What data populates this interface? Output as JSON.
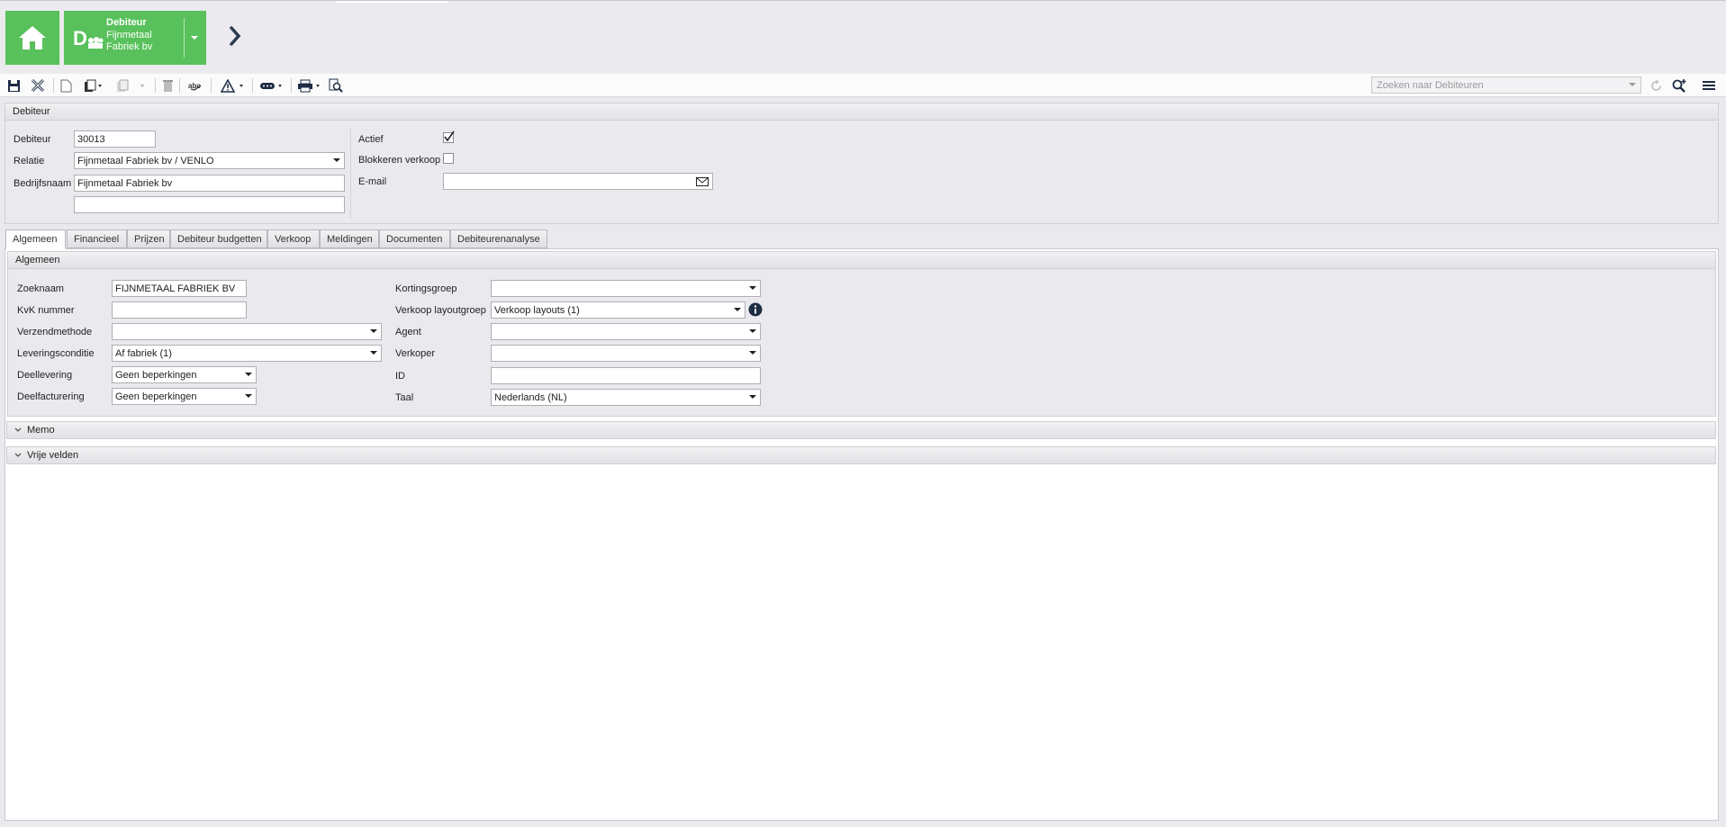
{
  "header": {
    "record_type": "Debiteur",
    "record_name": "Fijnmetaal Fabriek bv"
  },
  "toolbar": {
    "search_placeholder": "Zoeken naar Debiteuren"
  },
  "debiteur_panel": {
    "title": "Debiteur",
    "debiteur_label": "Debiteur",
    "debiteur_value": "30013",
    "relatie_label": "Relatie",
    "relatie_value": "Fijnmetaal Fabriek bv / VENLO",
    "bedrijfsnaam_label": "Bedrijfsnaam",
    "bedrijfsnaam_value": "Fijnmetaal Fabriek bv",
    "bedrijfsnaam2_value": "",
    "actief_label": "Actief",
    "actief_checked": true,
    "blokkeren_label": "Blokkeren verkoop",
    "blokkeren_checked": false,
    "email_label": "E-mail",
    "email_value": ""
  },
  "tabs": [
    {
      "label": "Algemeen",
      "active": true
    },
    {
      "label": "Financieel"
    },
    {
      "label": "Prijzen"
    },
    {
      "label": "Debiteur budgetten"
    },
    {
      "label": "Verkoop"
    },
    {
      "label": "Meldingen"
    },
    {
      "label": "Documenten"
    },
    {
      "label": "Debiteurenanalyse"
    }
  ],
  "algemeen": {
    "title": "Algemeen",
    "zoeknaam_label": "Zoeknaam",
    "zoeknaam_value": "FIJNMETAAL FABRIEK BV",
    "kvk_label": "KvK nummer",
    "kvk_value": "",
    "verzendmethode_label": "Verzendmethode",
    "verzendmethode_value": "",
    "leveringsconditie_label": "Leveringsconditie",
    "leveringsconditie_value": "Af fabriek (1)",
    "deellevering_label": "Deellevering",
    "deellevering_value": "Geen beperkingen",
    "deelfacturering_label": "Deelfacturering",
    "deelfacturering_value": "Geen beperkingen",
    "kortingsgroep_label": "Kortingsgroep",
    "kortingsgroep_value": "",
    "layoutgroep_label": "Verkoop layoutgroep",
    "layoutgroep_value": "Verkoop layouts (1)",
    "agent_label": "Agent",
    "agent_value": "",
    "verkoper_label": "Verkoper",
    "verkoper_value": "",
    "id_label": "ID",
    "id_value": "",
    "taal_label": "Taal",
    "taal_value": "Nederlands (NL)"
  },
  "sections": {
    "memo": "Memo",
    "vrije_velden": "Vrije velden"
  }
}
